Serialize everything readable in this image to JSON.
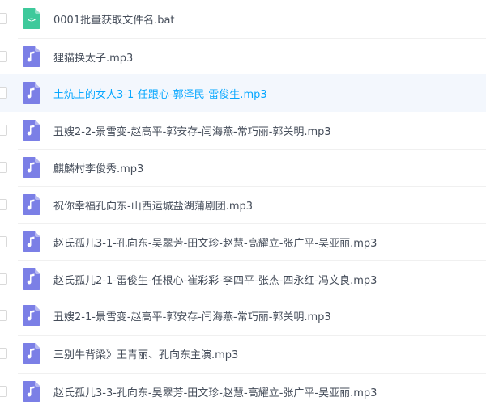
{
  "colors": {
    "audio_icon": "#7b7fe6",
    "code_icon": "#3ec99b",
    "selected_bg": "#f3f7fd",
    "selected_text": "#06a7ff",
    "text": "#454d5a"
  },
  "files": [
    {
      "name": "0001批量获取文件名.bat",
      "icon": "code-file-icon",
      "selected": false
    },
    {
      "name": "狸猫换太子.mp3",
      "icon": "audio-file-icon",
      "selected": false
    },
    {
      "name": "土炕上的女人3-1-任跟心-郭泽民-雷俊生.mp3",
      "icon": "audio-file-icon",
      "selected": true
    },
    {
      "name": "丑嫂2-2-景雪变-赵高平-郭安存-闫海燕-常巧丽-郭关明.mp3",
      "icon": "audio-file-icon",
      "selected": false
    },
    {
      "name": "麒麟村李俊秀.mp3",
      "icon": "audio-file-icon",
      "selected": false
    },
    {
      "name": "祝你幸福孔向东-山西运城盐湖蒲剧团.mp3",
      "icon": "audio-file-icon",
      "selected": false
    },
    {
      "name": "赵氏孤儿3-1-孔向东-吴翠芳-田文珍-赵慧-高耀立-张广平-吴亚丽.mp3",
      "icon": "audio-file-icon",
      "selected": false
    },
    {
      "name": "赵氏孤儿2-1-雷俊生-任根心-崔彩彩-李四平-张杰-四永红-冯文良.mp3",
      "icon": "audio-file-icon",
      "selected": false
    },
    {
      "name": "丑嫂2-1-景雪变-赵高平-郭安存-闫海燕-常巧丽-郭关明.mp3",
      "icon": "audio-file-icon",
      "selected": false
    },
    {
      "name": "三别牛背梁》王青丽、孔向东主演.mp3",
      "icon": "audio-file-icon",
      "selected": false
    },
    {
      "name": "赵氏孤儿3-3-孔向东-吴翠芳-田文珍-赵慧-高耀立-张广平-吴亚丽.mp3",
      "icon": "audio-file-icon",
      "selected": false
    }
  ]
}
